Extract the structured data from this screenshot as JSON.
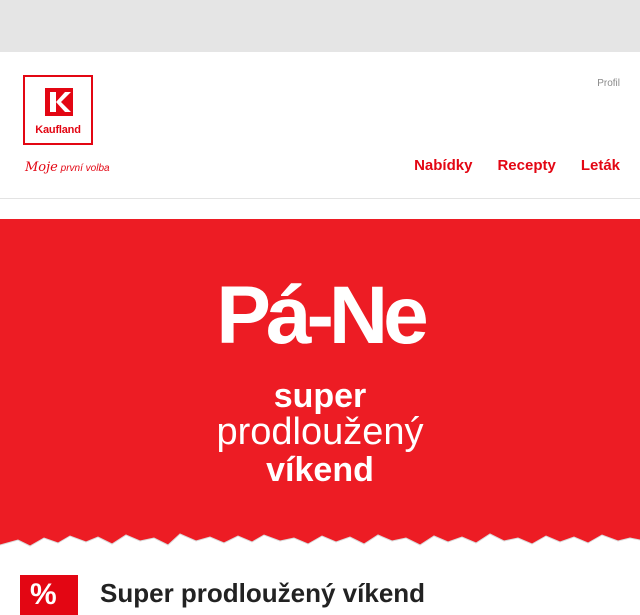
{
  "brand": {
    "logo_text": "Kaufland",
    "tagline_script": "Moje",
    "tagline_rest": "první volba"
  },
  "header": {
    "profile_label": "Profil",
    "nav": [
      {
        "label": "Nabídky"
      },
      {
        "label": "Recepty"
      },
      {
        "label": "Leták"
      }
    ]
  },
  "hero": {
    "title": "Pá-Ne",
    "line1": "super",
    "line2": "prodloužený",
    "line3": "víkend"
  },
  "section": {
    "badge_symbol": "%",
    "title": "Super prodloužený víkend"
  },
  "colors": {
    "brand_red": "#e30613",
    "hero_red": "#ed1c24",
    "top_strip": "#e5e5e5"
  }
}
